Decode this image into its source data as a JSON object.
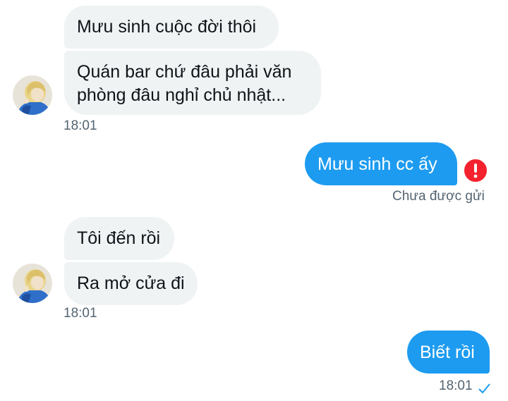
{
  "conversation": {
    "group1": {
      "messages": [
        {
          "text": "Mưu sinh cuộc đời thôi"
        },
        {
          "text": "Quán bar chứ đâu phải văn phòng đâu nghỉ chủ nhật..."
        }
      ],
      "time": "18:01"
    },
    "outgoing1": {
      "text": "Mưu sinh cc ấy",
      "status": "Chưa được gửi"
    },
    "group2": {
      "messages": [
        {
          "text": "Tôi đến rồi"
        },
        {
          "text": "Ra mở cửa đi"
        }
      ],
      "time": "18:01"
    },
    "outgoing2": {
      "text": "Biết rồi",
      "time": "18:01"
    }
  },
  "colors": {
    "incoming_bubble": "#eff3f4",
    "outgoing_bubble": "#1d9bf0",
    "error": "#f4212e",
    "meta_text": "#536471"
  },
  "icons": {
    "error": "error-icon",
    "sent": "check-icon"
  }
}
